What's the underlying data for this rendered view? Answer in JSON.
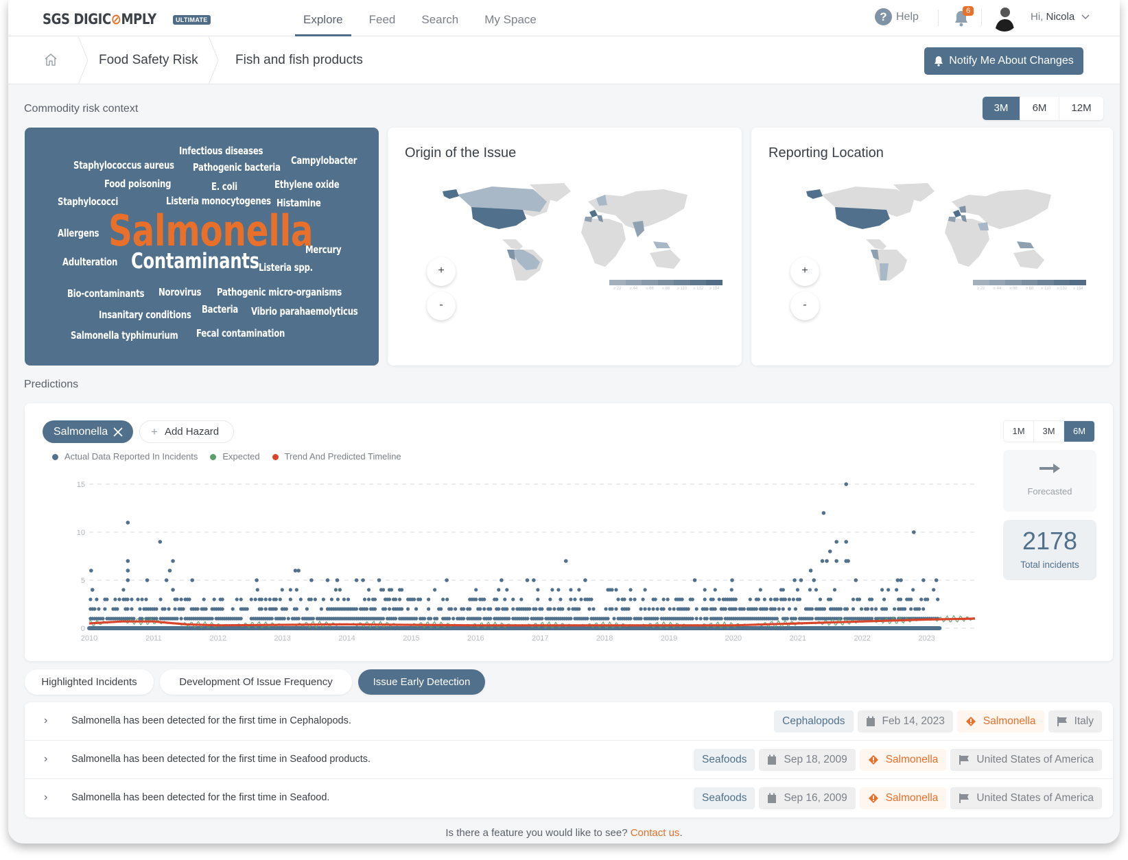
{
  "header": {
    "logo_text_1": "SGS DIGIC",
    "logo_text_o": "⊘",
    "logo_text_2": "MPLY",
    "plan_badge": "ULTIMATE",
    "nav": [
      {
        "label": "Explore",
        "active": true
      },
      {
        "label": "Feed",
        "active": false
      },
      {
        "label": "Search",
        "active": false
      },
      {
        "label": "My Space",
        "active": false
      }
    ],
    "help_label": "Help",
    "notification_count": "6",
    "greeting": "Hi,",
    "user_name": "Nicola"
  },
  "breadcrumb": {
    "items": [
      "Food Safety Risk",
      "Fish and fish products"
    ],
    "notify_button": "Notify Me About Changes"
  },
  "commodity": {
    "title": "Commodity risk context",
    "periods": [
      {
        "label": "3M",
        "active": true
      },
      {
        "label": "6M",
        "active": false
      },
      {
        "label": "12M",
        "active": false
      }
    ],
    "word_cloud": [
      {
        "text": "Infectious diseases",
        "weight": 1
      },
      {
        "text": "Staphylococcus aureus",
        "weight": 1
      },
      {
        "text": "Pathogenic bacteria",
        "weight": 1
      },
      {
        "text": "Campylobacter",
        "weight": 1
      },
      {
        "text": "Food poisoning",
        "weight": 1
      },
      {
        "text": "E. coli",
        "weight": 1
      },
      {
        "text": "Ethylene oxide",
        "weight": 1
      },
      {
        "text": "Staphylococci",
        "weight": 1
      },
      {
        "text": "Listeria monocytogenes",
        "weight": 1
      },
      {
        "text": "Histamine",
        "weight": 1
      },
      {
        "text": "Allergens",
        "weight": 1
      },
      {
        "text": "Salmonella",
        "weight": 5
      },
      {
        "text": "Mercury",
        "weight": 1
      },
      {
        "text": "Adulteration",
        "weight": 1
      },
      {
        "text": "Contaminants",
        "weight": 2.5
      },
      {
        "text": "Listeria spp.",
        "weight": 1
      },
      {
        "text": "Bio-contaminants",
        "weight": 1
      },
      {
        "text": "Norovirus",
        "weight": 1
      },
      {
        "text": "Pathogenic micro-organisms",
        "weight": 1
      },
      {
        "text": "Insanitary conditions",
        "weight": 1
      },
      {
        "text": "Bacteria",
        "weight": 1
      },
      {
        "text": "Vibrio parahaemolyticus",
        "weight": 1
      },
      {
        "text": "Salmonella typhimurium",
        "weight": 1
      },
      {
        "text": "Fecal contamination",
        "weight": 1
      }
    ],
    "origin_map": {
      "title": "Origin of the Issue",
      "zoom_in": "+",
      "zoom_out": "-",
      "highlighted": [
        "United States of America",
        "Alaska",
        "Canada",
        "France",
        "Spain",
        "Italy",
        "Norway",
        "India",
        "Vietnam",
        "Indonesia",
        "Peru",
        "Ecuador",
        "Brazil"
      ],
      "legend": [
        "≥ 22",
        "≥ 44",
        "≥ 66",
        "≥ 88",
        "≥ 110",
        "≥ 132",
        "≥ 154"
      ]
    },
    "reporting_map": {
      "title": "Reporting Location",
      "zoom_in": "+",
      "zoom_out": "-",
      "highlighted": [
        "United States of America",
        "Alaska",
        "France",
        "Spain",
        "Italy",
        "Germany",
        "Saudi Arabia",
        "Peru",
        "Argentina",
        "Indonesia"
      ],
      "legend": [
        "≥ 22",
        "≥ 44",
        "≥ 66",
        "≥ 88",
        "≥ 110",
        "≥ 132",
        "≥ 154"
      ]
    }
  },
  "predictions": {
    "title": "Predictions",
    "hazard_chip": "Salmonella",
    "add_hazard": "Add Hazard",
    "legend": [
      {
        "label": "Actual Data Reported In Incidents",
        "color": "#50708b"
      },
      {
        "label": "Expected",
        "color": "#5a9e6a"
      },
      {
        "label": "Trend And Predicted Timeline",
        "color": "#d9442b"
      }
    ],
    "periods": [
      {
        "label": "1M",
        "active": false
      },
      {
        "label": "3M",
        "active": false
      },
      {
        "label": "6M",
        "active": true
      }
    ],
    "trend_label": "Forecasted",
    "total_value": "2178",
    "total_label": "Total incidents"
  },
  "chart_data": {
    "type": "scatter",
    "title": "",
    "xlabel": "",
    "ylabel": "",
    "x_ticks": [
      "2010",
      "2011",
      "2012",
      "2013",
      "2014",
      "2015",
      "2016",
      "2017",
      "2018",
      "2019",
      "2020",
      "2021",
      "2022",
      "2023"
    ],
    "y_ticks": [
      0,
      5,
      10,
      15
    ],
    "xlim": [
      2010.0,
      2023.75
    ],
    "ylim": [
      0,
      15
    ],
    "grid": "horizontal-dashed",
    "series": [
      {
        "name": "Actual Data Reported In Incidents",
        "color": "#50708b",
        "note": "daily incident counts; dense rows at 0-3, selected notable points listed",
        "points": [
          [
            2010.03,
            6
          ],
          [
            2010.05,
            4
          ],
          [
            2010.6,
            11
          ],
          [
            2010.6,
            7
          ],
          [
            2010.6,
            6
          ],
          [
            2010.6,
            5
          ],
          [
            2010.9,
            5
          ],
          [
            2011.1,
            9
          ],
          [
            2011.2,
            5
          ],
          [
            2011.25,
            6
          ],
          [
            2011.3,
            7
          ],
          [
            2011.3,
            4
          ],
          [
            2011.6,
            5
          ],
          [
            2012.6,
            5
          ],
          [
            2013.2,
            6
          ],
          [
            2013.25,
            6
          ],
          [
            2013.45,
            5
          ],
          [
            2013.7,
            5
          ],
          [
            2013.85,
            5
          ],
          [
            2014.15,
            5
          ],
          [
            2014.25,
            5
          ],
          [
            2014.5,
            5
          ],
          [
            2015.55,
            5
          ],
          [
            2016.4,
            5
          ],
          [
            2016.8,
            5
          ],
          [
            2016.9,
            5
          ],
          [
            2017.4,
            7
          ],
          [
            2017.7,
            5
          ],
          [
            2019.4,
            5
          ],
          [
            2019.98,
            5
          ],
          [
            2020.95,
            5
          ],
          [
            2021.05,
            5
          ],
          [
            2021.2,
            6
          ],
          [
            2021.25,
            5
          ],
          [
            2021.4,
            12
          ],
          [
            2021.38,
            7
          ],
          [
            2021.45,
            7
          ],
          [
            2021.5,
            8
          ],
          [
            2021.6,
            9
          ],
          [
            2021.6,
            7
          ],
          [
            2021.75,
            15
          ],
          [
            2021.75,
            9
          ],
          [
            2021.75,
            7
          ],
          [
            2021.78,
            7
          ],
          [
            2021.9,
            5
          ],
          [
            2022.55,
            5
          ],
          [
            2022.6,
            5
          ],
          [
            2022.8,
            10
          ],
          [
            2022.95,
            5
          ],
          [
            2023.15,
            5
          ]
        ]
      },
      {
        "name": "Expected",
        "color": "#5a9e6a",
        "note": "oscillating band around trend, approx 0.3-1.2",
        "range": [
          0,
          1.2
        ]
      },
      {
        "name": "Trend And Predicted Timeline",
        "color": "#d9442b",
        "x": [
          2010.0,
          2010.5,
          2011.0,
          2011.5,
          2012.0,
          2014.0,
          2016.0,
          2018.0,
          2020.0,
          2021.0,
          2022.0,
          2023.0,
          2023.75
        ],
        "y": [
          0.5,
          0.7,
          0.7,
          0.4,
          0.3,
          0.4,
          0.3,
          0.3,
          0.3,
          0.5,
          0.7,
          0.9,
          1.0
        ]
      }
    ]
  },
  "tabs": [
    {
      "label": "Highlighted Incidents",
      "active": false
    },
    {
      "label": "Development Of Issue Frequency",
      "active": false
    },
    {
      "label": "Issue Early Detection",
      "active": true
    }
  ],
  "incidents": [
    {
      "text": "Salmonella has been detected for the first time in Cephalopods.",
      "category": "Cephalopods",
      "date": "Feb 14, 2023",
      "hazard": "Salmonella",
      "country": "Italy"
    },
    {
      "text": "Salmonella has been detected for the first time in Seafood products.",
      "category": "Seafoods",
      "date": "Sep 18, 2009",
      "hazard": "Salmonella",
      "country": "United States of America"
    },
    {
      "text": "Salmonella has been detected for the first time in Seafood.",
      "category": "Seafoods",
      "date": "Sep 16, 2009",
      "hazard": "Salmonella",
      "country": "United States of America"
    }
  ],
  "footer": {
    "question": "Is there a feature you would like to see? ",
    "link": "Contact us",
    "end": "."
  },
  "colors": {
    "primary": "#50708b",
    "accent": "#e8702a",
    "actual": "#50708b",
    "expected": "#5a9e6a",
    "trend": "#d9442b"
  }
}
